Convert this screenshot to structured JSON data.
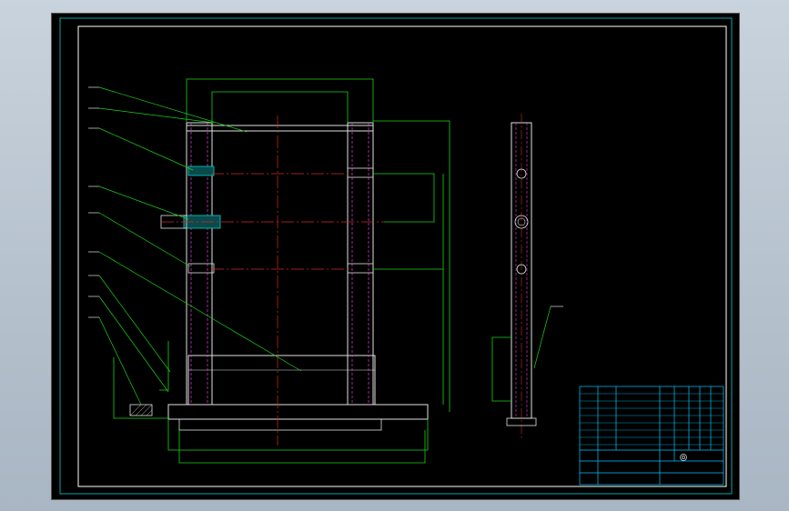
{
  "drawing": {
    "corner_label": "",
    "tech_requirements": {
      "title": "",
      "items": [
        "",
        "",
        ""
      ]
    },
    "colors": {
      "frame": "#ffffff",
      "part_outline": "#e0e0e0",
      "dimension": "#19d419",
      "center_line": "#d62828",
      "hidden_line": "#e040e0",
      "hatch_fill": "#00d0d0",
      "annotation": "#2060ff",
      "title_block": "#00c8ff"
    }
  }
}
